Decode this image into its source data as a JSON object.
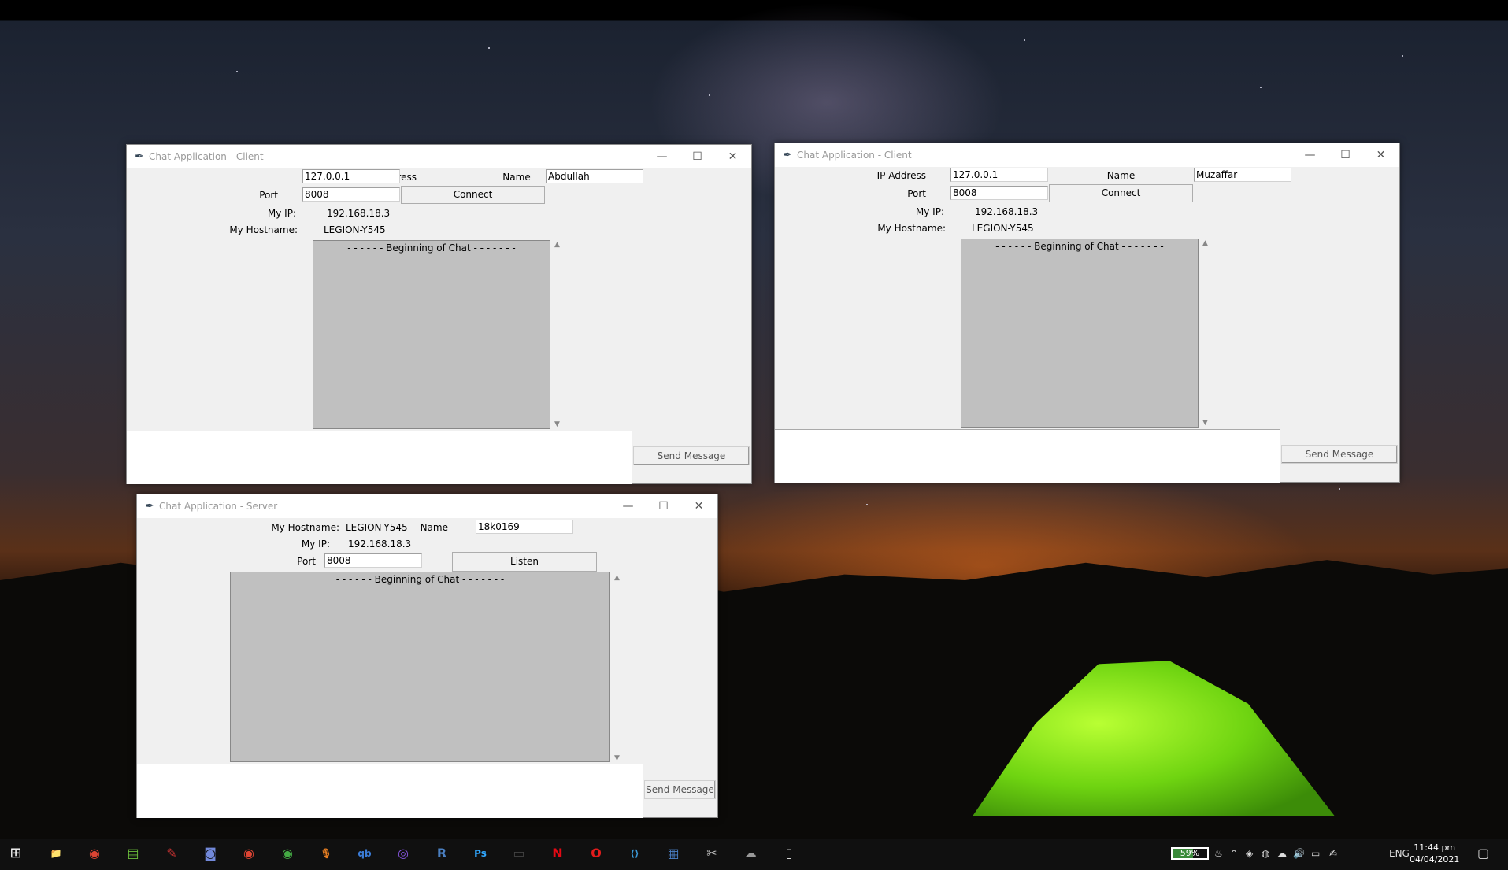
{
  "client1": {
    "title": "Chat Application - Client",
    "ip_label": "IP Address",
    "ip_value": "127.0.0.1",
    "name_label": "Name",
    "name_value": "Abdullah",
    "port_label": "Port",
    "port_value": "8008",
    "connect_label": "Connect",
    "myip_label": "My IP:",
    "myip_value": "192.168.18.3",
    "hostname_label": "My Hostname:",
    "hostname_value": "LEGION-Y545",
    "chat_text": "- - - - - - Beginning of Chat - - - - - - -",
    "send_label": "Send Message"
  },
  "client2": {
    "title": "Chat Application - Client",
    "ip_label": "IP Address",
    "ip_value": "127.0.0.1",
    "name_label": "Name",
    "name_value": "Muzaffar",
    "port_label": "Port",
    "port_value": "8008",
    "connect_label": "Connect",
    "myip_label": "My IP:",
    "myip_value": "192.168.18.3",
    "hostname_label": "My Hostname:",
    "hostname_value": "LEGION-Y545",
    "chat_text": "- - - - - - Beginning of Chat - - - - - - -",
    "send_label": "Send Message"
  },
  "server": {
    "title": "Chat Application - Server",
    "hostname_label": "My Hostname:",
    "hostname_value": "LEGION-Y545",
    "name_label": "Name",
    "name_value": "18k0169",
    "myip_label": "My IP:",
    "myip_value": "192.168.18.3",
    "port_label": "Port",
    "port_value": "8008",
    "listen_label": "Listen",
    "chat_text": "- - - - - - Beginning of Chat - - - - - - -",
    "send_label": "Send Message"
  },
  "window_controls": {
    "minimize": "—",
    "maximize": "☐",
    "close": "✕"
  },
  "taskbar": {
    "start_icon": "windows-start-icon",
    "apps": [
      "file-explorer-icon",
      "chrome-icon",
      "notepad-plus-icon",
      "paint-icon",
      "discord-icon",
      "chrome-icon",
      "chrome-icon",
      "podcast-icon",
      "qbittorrent-icon",
      "github-icon",
      "r-icon",
      "photoshop-icon",
      "terminal-icon",
      "netflix-icon",
      "opera-icon",
      "vscode-icon",
      "calculator-icon",
      "snipping-icon",
      "cloud-icon",
      "document-icon"
    ],
    "app_glyphs": [
      "📁",
      "◉",
      "▤",
      "✎",
      "◙",
      "◉",
      "◉",
      "🎙",
      "qb",
      "◎",
      "R",
      "Ps",
      "▭",
      "N",
      "O",
      "⟨⟩",
      "▦",
      "✂",
      "☁",
      "▯"
    ],
    "app_colors": [
      "#e8b400",
      "#dd4433",
      "#6cbf3c",
      "#c33",
      "#7289da",
      "#dd4433",
      "#4a4",
      "#e67e22",
      "#3a7bd5",
      "#8957e5",
      "#4a7fc1",
      "#31a8ff",
      "#444",
      "#e50914",
      "#e31c1c",
      "#3a9ad9",
      "#4a80c8",
      "#bbb",
      "#999",
      "#eee"
    ],
    "battery_percent": "59%",
    "language": "ENG",
    "time": "11:44 pm",
    "date": "04/04/2021"
  }
}
